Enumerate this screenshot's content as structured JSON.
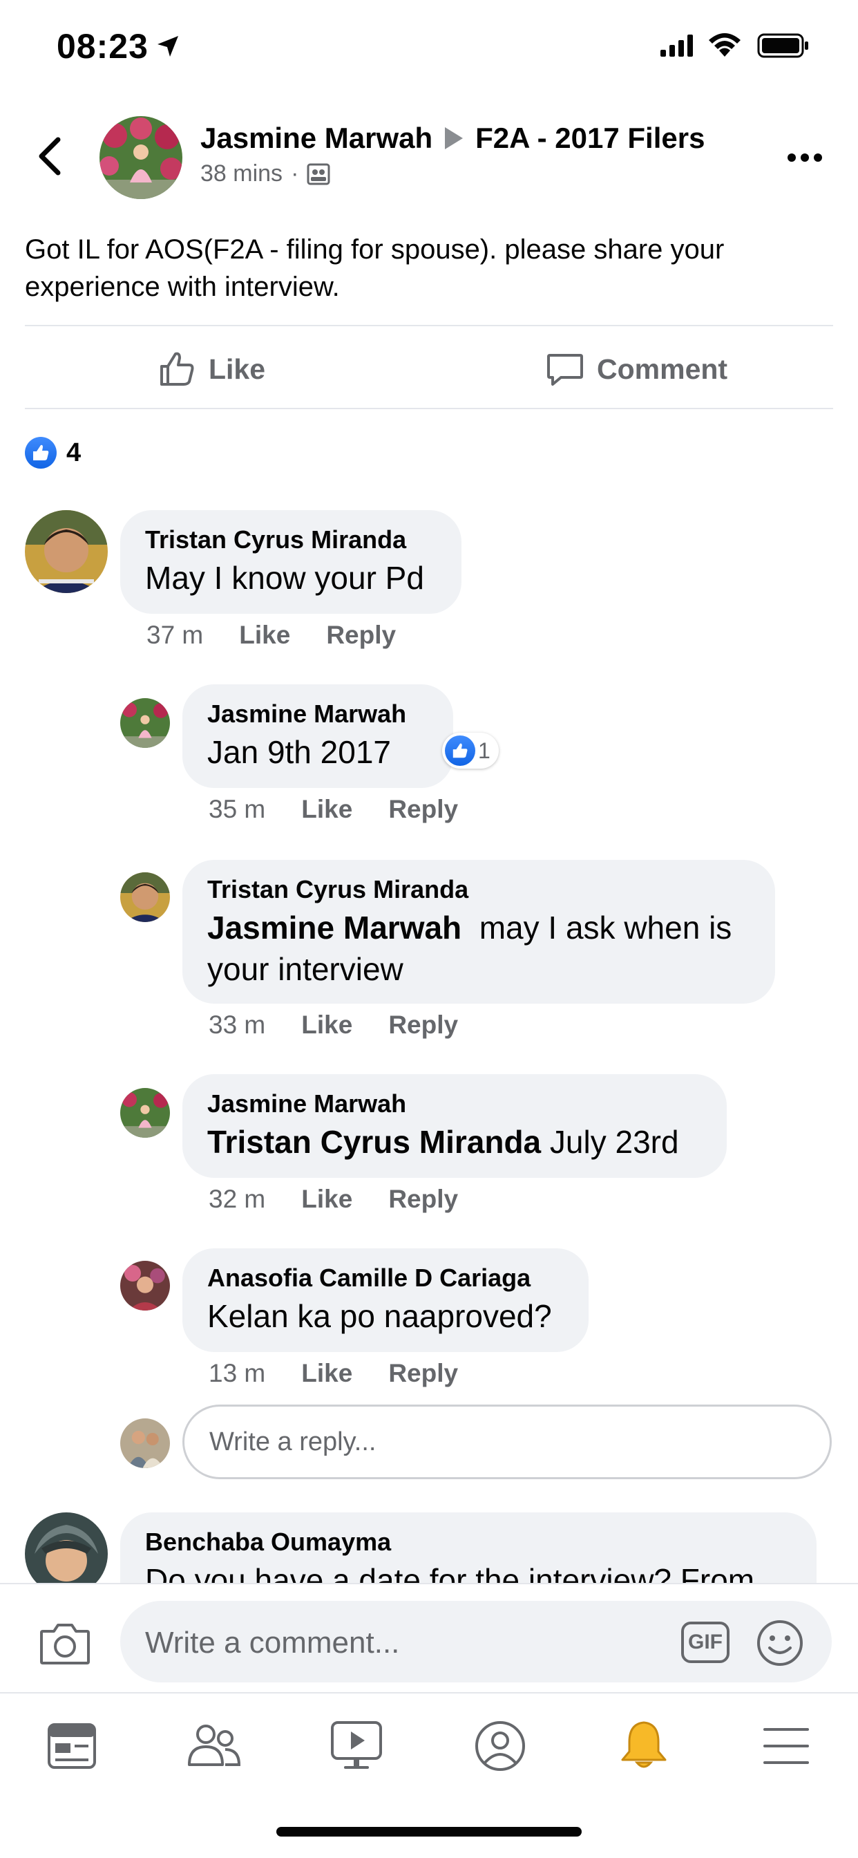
{
  "status_bar": {
    "time": "08:23"
  },
  "post": {
    "author": "Jasmine Marwah",
    "group": "F2A - 2017 Filers",
    "time": "38 mins",
    "dot": "·",
    "text": "Got IL for AOS(F2A - filing for spouse). please share your experience with interview.",
    "like_label": "Like",
    "comment_label": "Comment",
    "reaction_count": "4"
  },
  "comments": [
    {
      "name": "Tristan Cyrus Miranda",
      "text": "May I know your Pd",
      "time": "37 m",
      "like": "Like",
      "reply": "Reply"
    },
    {
      "name": "Jasmine Marwah",
      "text": "Jan 9th 2017",
      "time": "35 m",
      "like": "Like",
      "reply": "Reply",
      "reaction_count": "1"
    },
    {
      "name": "Tristan Cyrus Miranda",
      "mention": "Jasmine Marwah",
      "text": "may I ask when is your interview",
      "time": "33 m",
      "like": "Like",
      "reply": "Reply"
    },
    {
      "name": "Jasmine Marwah",
      "mention": "Tristan Cyrus Miranda",
      "text": "July 23rd",
      "time": "32 m",
      "like": "Like",
      "reply": "Reply"
    },
    {
      "name": "Anasofia Camille D Cariaga",
      "text": "Kelan ka po naaproved?",
      "time": "13 m",
      "like": "Like",
      "reply": "Reply"
    },
    {
      "name": "Benchaba Oumayma",
      "text": "Do you have a date for the interview? From"
    }
  ],
  "reply_box": {
    "placeholder": "Write a reply..."
  },
  "composer": {
    "placeholder": "Write a comment...",
    "gif_label": "GIF"
  },
  "tabs": [
    "news-feed-icon",
    "friends-icon",
    "watch-icon",
    "profile-icon",
    "notifications-icon",
    "menu-icon"
  ],
  "colors": {
    "accent": "#1877f2",
    "secondary_text": "#65676b",
    "bubble": "#f0f2f5",
    "bell": "#f7b928"
  }
}
